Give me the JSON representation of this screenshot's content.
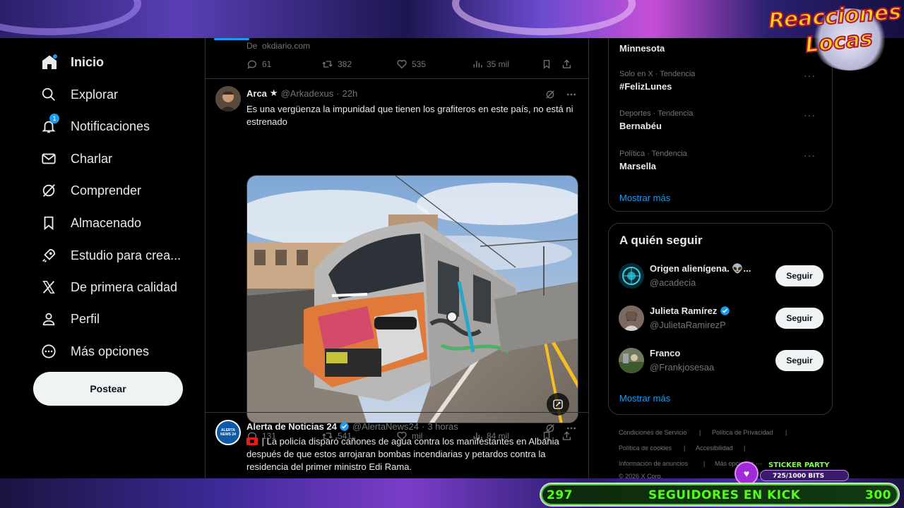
{
  "overlay": {
    "logo_line1": "Reacciones",
    "logo_line2": "Locas",
    "sticker_title": "STICKER PARTY",
    "sticker_progress": "725/1000 BITS",
    "kick_left": "297",
    "kick_label": "SEGUIDORES EN KICK",
    "kick_right": "300"
  },
  "sidebar": {
    "items": [
      {
        "label": "Inicio",
        "icon": "home-icon"
      },
      {
        "label": "Explorar",
        "icon": "search-icon"
      },
      {
        "label": "Notificaciones",
        "icon": "bell-icon",
        "badge": "1"
      },
      {
        "label": "Charlar",
        "icon": "mail-icon"
      },
      {
        "label": "Comprender",
        "icon": "grok-icon"
      },
      {
        "label": "Almacenado",
        "icon": "bookmark-icon"
      },
      {
        "label": "Estudio para crea...",
        "icon": "rocket-icon"
      },
      {
        "label": "De primera calidad",
        "icon": "x-logo-icon"
      },
      {
        "label": "Perfil",
        "icon": "person-icon"
      },
      {
        "label": "Más opciones",
        "icon": "more-circle-icon"
      }
    ],
    "post_button": "Postear"
  },
  "timeline": {
    "prev_tweet": {
      "source_prefix": "De",
      "source": "okdiario.com",
      "replies": "61",
      "reposts": "382",
      "likes": "535",
      "views": "35 mil"
    },
    "tweet1": {
      "name": "Arca",
      "star": "★",
      "handle": "@Arkadexus",
      "time": "22h",
      "text": "Es una vergüenza la impunidad que tienen los grafiteros en este país, no está ni estrenado",
      "replies": "131",
      "reposts": "541",
      "likes": "mil",
      "views": "84 mil"
    },
    "tweet2": {
      "name": "Alerta de Noticias 24",
      "handle": "@AlertaNews24",
      "time": "3 horas",
      "text": "| La policía disparó cañones de agua contra los manifestantes en Albania después de que estos arrojaran bombas incendiarias y petardos contra la residencia del primer ministro Edi Rama.",
      "avatar_text": "ALERTA NEWS 24"
    }
  },
  "trends": [
    {
      "category": "",
      "topic": "Minnesota"
    },
    {
      "category": "Solo en X · Tendencia",
      "topic": "#FelizLunes"
    },
    {
      "category": "Deportes · Tendencia",
      "topic": "Bernabéu"
    },
    {
      "category": "Política · Tendencia",
      "topic": "Marsella"
    }
  ],
  "trends_show_more": "Mostrar más",
  "who_to_follow": {
    "title": "A quién seguir",
    "users": [
      {
        "name": "Origen alienígena. 👽...",
        "handle": "@acadecia",
        "button": "Seguir"
      },
      {
        "name": "Julieta Ramírez",
        "handle": "@JulietaRamirezP",
        "button": "Seguir"
      },
      {
        "name": "Franco",
        "handle": "@Frankjosesaa",
        "button": "Seguir"
      }
    ],
    "show_more": "Mostrar más"
  },
  "footer": {
    "terms": "Condiciones de Servicio",
    "privacy": "Política de Privacidad",
    "cookies": "Política de cookies",
    "accessibility": "Accesibilidad",
    "ads": "Información de anuncios",
    "more": "Más opciones ···",
    "copyright": "© 2026 X Corp."
  },
  "colors": {
    "accent": "#1d9bf0",
    "background": "#000000",
    "border": "#2f3336",
    "muted": "#71767b"
  }
}
